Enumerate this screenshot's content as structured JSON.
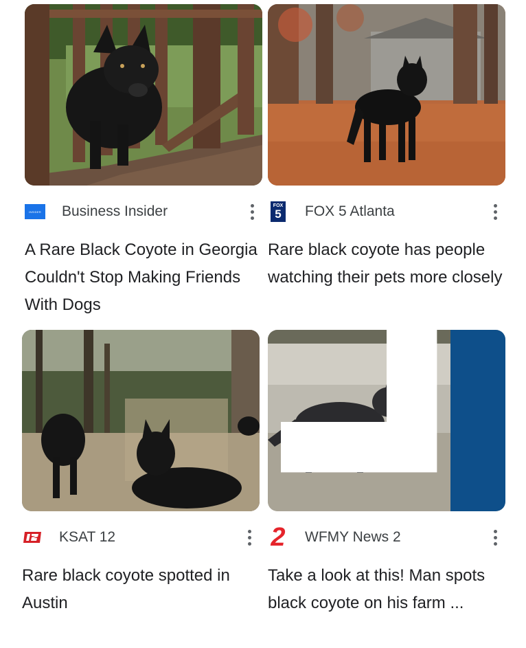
{
  "cards": [
    {
      "source": "Business Insider",
      "logo_text": "INSIDER",
      "headline": "A Rare Black Coyote in Georgia Couldn't Stop Making Friends With Dogs",
      "image": "black coyote behind wooden deck railing"
    },
    {
      "source": "FOX 5 Atlanta",
      "logo_text": "FOX",
      "logo_number": "5",
      "headline": "Rare black coyote has people watching their pets more closely",
      "image": "black coyote standing on autumn leaves"
    },
    {
      "source": "KSAT 12",
      "logo_text": "12",
      "headline": "Rare black coyote spotted in Austin",
      "image": "two black coyotes in a wooded field"
    },
    {
      "source": "WFMY News 2",
      "logo_text": "2",
      "headline": "Take a look at this! Man spots black coyote on his farm ...",
      "image": "dark coyote walking across frosty grass"
    }
  ],
  "icons": {
    "more": "more-vert-icon",
    "corner": "corner-bracket-icon"
  },
  "colors": {
    "headline": "#202124",
    "source": "#3c4043",
    "insider_blue": "#1a73e8",
    "fox_navy": "#0b2a6f",
    "ksat_red": "#d62027",
    "wfmy_red": "#e5242b",
    "panel_blue": "#0e4f8a"
  }
}
